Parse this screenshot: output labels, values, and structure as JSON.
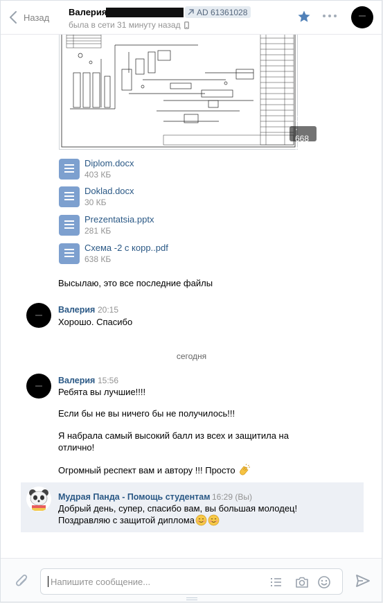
{
  "header": {
    "back_label": "Назад",
    "user_name": "Валерия",
    "ad_label": "AD 61361028",
    "status": "была в сети 31 минуту назад"
  },
  "history": {
    "image_badge": "JPG · 668 КБ",
    "files": [
      {
        "name": "Diplom.docx",
        "size": "403 КБ"
      },
      {
        "name": "Doklad.docx",
        "size": "30 КБ"
      },
      {
        "name": "Prezentatsia.pptx",
        "size": "281 КБ"
      },
      {
        "name": "Схема -2 с корр..pdf",
        "size": "638 КБ"
      }
    ],
    "msg_files_note": "Высылаю, это все последние файлы",
    "msg1": {
      "author": "Валерия",
      "time": "20:15",
      "text": "Хорошо. Спасибо"
    },
    "day_divider": "сегодня",
    "msg2": {
      "author": "Валерия",
      "time": "15:56",
      "lines": [
        "Ребята вы лучшие!!!!",
        "Если бы не вы ничего бы не получилось!!!",
        "Я набрала самый высокий балл из всех и защитила на",
        "отлично!",
        "Огромный респект вам и автору !!! Просто"
      ]
    },
    "msg3": {
      "author": "Мудрая Панда - Помощь студентам",
      "time": "16:29 (Вы)",
      "line1": "Добрый день, супер, спасибо вам, вы большая молодец!",
      "line2": "Поздравляю с защитой диплома"
    }
  },
  "composer": {
    "placeholder": "Напишите сообщение..."
  },
  "colors": {
    "accent": "#5181b8",
    "link": "#2a5885",
    "muted": "#939393",
    "doc_icon": "#7da0cf",
    "highlight": "#edf0f5"
  }
}
